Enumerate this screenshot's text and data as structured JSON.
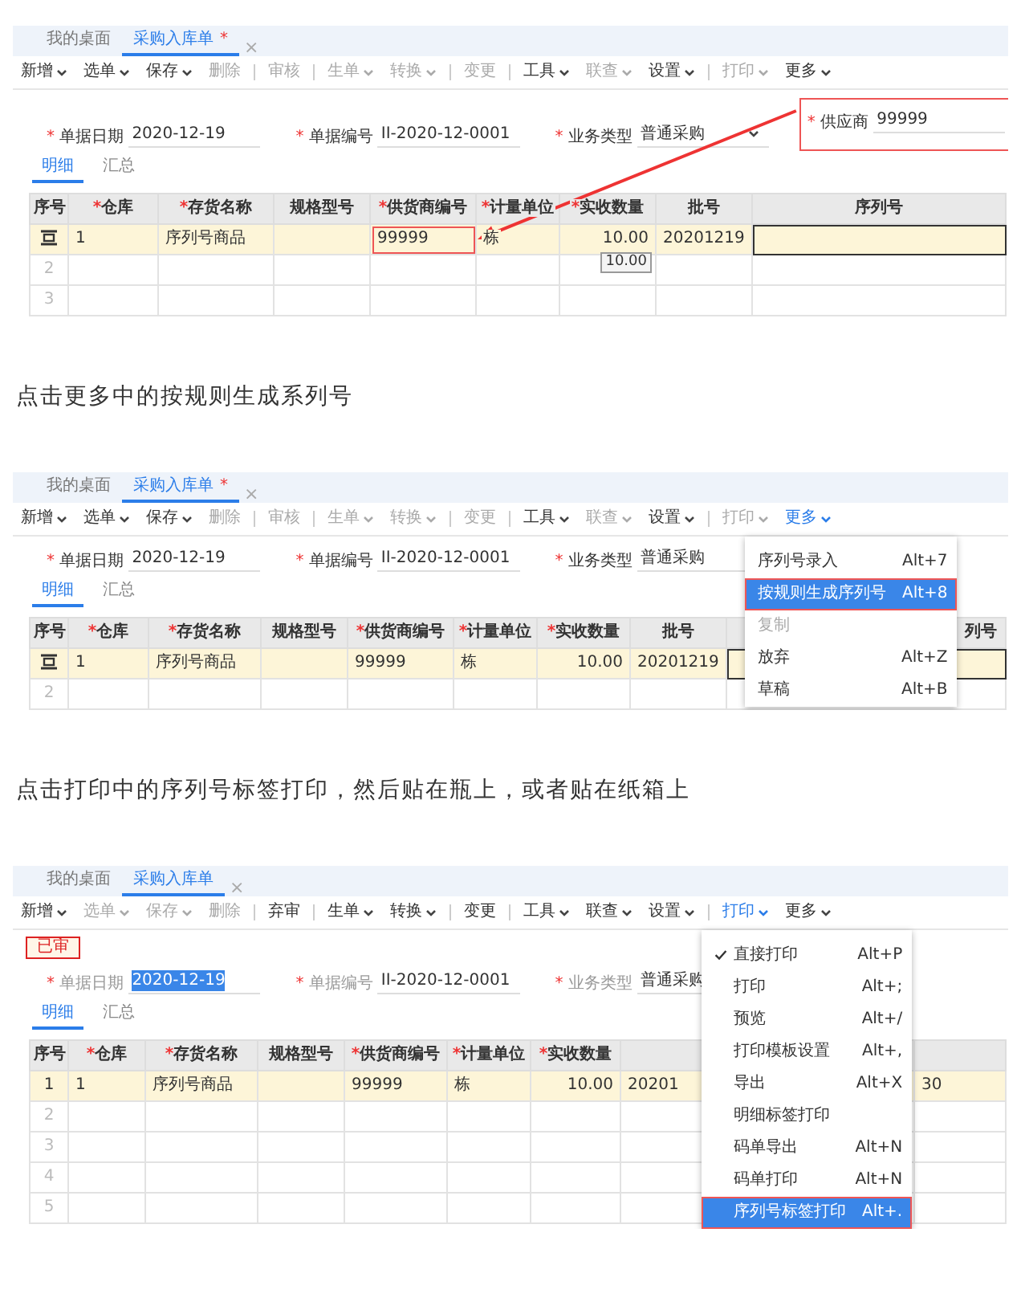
{
  "blocks": [
    {
      "kind": "screen",
      "arrow": true,
      "tabs": [
        {
          "label": "我的桌面",
          "selected": false
        },
        {
          "label": "采购入库单",
          "mark": "*",
          "selected": true,
          "close": "×"
        }
      ],
      "toolbar": [
        {
          "label": "新增",
          "dropdown": true,
          "disabled": false
        },
        {
          "label": "选单",
          "dropdown": true,
          "disabled": false
        },
        {
          "label": "保存",
          "dropdown": true,
          "disabled": false
        },
        {
          "label": "删除",
          "disabled": true
        },
        {
          "label": "审核",
          "disabled": true,
          "divider_before": true
        },
        {
          "label": "生单",
          "dropdown": true,
          "disabled": true,
          "divider_before": true
        },
        {
          "label": "转换",
          "dropdown": true,
          "disabled": true
        },
        {
          "label": "变更",
          "disabled": true,
          "divider_before": true
        },
        {
          "label": "工具",
          "dropdown": true,
          "disabled": false,
          "divider_before": true
        },
        {
          "label": "联查",
          "dropdown": true,
          "disabled": true
        },
        {
          "label": "设置",
          "dropdown": true,
          "disabled": false
        },
        {
          "label": "打印",
          "dropdown": true,
          "disabled": true,
          "divider_before": true
        },
        {
          "label": "更多",
          "dropdown": true,
          "disabled": false
        }
      ],
      "fields": [
        {
          "mark": "*",
          "label": "单据日期",
          "value": "2020-12-19"
        },
        {
          "mark": "*",
          "label": "单据编号",
          "value": "II-2020-12-0001"
        },
        {
          "mark": "*",
          "label": "业务类型",
          "value": "普通采购",
          "select": true
        },
        {
          "mark": "*",
          "label": "供应商",
          "value": "99999",
          "highlight": true
        }
      ],
      "subtabs": [
        {
          "label": "明细",
          "selected": true
        },
        {
          "label": "汇总",
          "selected": false
        }
      ],
      "columns": [
        {
          "label": "序号"
        },
        {
          "mark": "*",
          "label": "仓库"
        },
        {
          "mark": "*",
          "label": "存货名称"
        },
        {
          "label": "规格型号"
        },
        {
          "mark": "*",
          "label": "供货商编号"
        },
        {
          "mark": "*",
          "label": "计量单位"
        },
        {
          "mark": "*",
          "label": "实收数量"
        },
        {
          "label": "批号"
        },
        {
          "label": "序列号"
        }
      ],
      "rows": [
        {
          "kind": "editing",
          "selected": true,
          "cells": [
            {},
            {
              "text": "1"
            },
            {
              "text": "序列号商品"
            },
            {},
            {
              "text": "99999",
              "highlight": true
            },
            {
              "text": "栋"
            },
            {
              "text": "10.00",
              "tooltip": "10.00"
            },
            {
              "text": "20201219"
            },
            {
              "focused": true
            }
          ]
        },
        {
          "kind": "plain",
          "selected": false,
          "cells": [
            {
              "text": "2"
            },
            {},
            {},
            {},
            {},
            {},
            {},
            {},
            {}
          ]
        },
        {
          "kind": "plain",
          "selected": false,
          "cells": [
            {
              "text": "3"
            },
            {},
            {},
            {},
            {},
            {},
            {},
            {},
            {}
          ]
        }
      ]
    },
    {
      "kind": "caption",
      "text": "点击更多中的按规则生成系列号"
    },
    {
      "kind": "screen",
      "tabs": [
        {
          "label": "我的桌面",
          "selected": false
        },
        {
          "label": "采购入库单",
          "mark": "*",
          "selected": true,
          "close": "×"
        }
      ],
      "toolbar": [
        {
          "label": "新增",
          "dropdown": true,
          "disabled": false
        },
        {
          "label": "选单",
          "dropdown": true,
          "disabled": false
        },
        {
          "label": "保存",
          "dropdown": true,
          "disabled": false
        },
        {
          "label": "删除",
          "disabled": true
        },
        {
          "label": "审核",
          "disabled": true,
          "divider_before": true
        },
        {
          "label": "生单",
          "dropdown": true,
          "disabled": true,
          "divider_before": true
        },
        {
          "label": "转换",
          "dropdown": true,
          "disabled": true
        },
        {
          "label": "变更",
          "disabled": true,
          "divider_before": true
        },
        {
          "label": "工具",
          "dropdown": true,
          "disabled": false,
          "divider_before": true
        },
        {
          "label": "联查",
          "dropdown": true,
          "disabled": true
        },
        {
          "label": "设置",
          "dropdown": true,
          "disabled": false
        },
        {
          "label": "打印",
          "dropdown": true,
          "disabled": true,
          "divider_before": true
        },
        {
          "label": "更多",
          "dropdown": true,
          "disabled": false,
          "open": true
        }
      ],
      "fields": [
        {
          "mark": "*",
          "label": "单据日期",
          "value": "2020-12-19"
        },
        {
          "mark": "*",
          "label": "单据编号",
          "value": "II-2020-12-0001"
        },
        {
          "mark": "*",
          "label": "业务类型",
          "value": "普通采购",
          "select": true
        }
      ],
      "subtabs": [
        {
          "label": "明细",
          "selected": true
        },
        {
          "label": "汇总",
          "selected": false
        }
      ],
      "columns": [
        {
          "label": "序号"
        },
        {
          "mark": "*",
          "label": "仓库"
        },
        {
          "mark": "*",
          "label": "存货名称"
        },
        {
          "label": "规格型号"
        },
        {
          "mark": "*",
          "label": "供货商编号"
        },
        {
          "mark": "*",
          "label": "计量单位"
        },
        {
          "mark": "*",
          "label": "实收数量"
        },
        {
          "label": "批号"
        },
        {
          "label": "列号"
        }
      ],
      "rows": [
        {
          "kind": "editing",
          "selected": true,
          "cells": [
            {},
            {
              "text": "1"
            },
            {
              "text": "序列号商品"
            },
            {},
            {
              "text": "99999"
            },
            {
              "text": "栋"
            },
            {
              "text": "10.00"
            },
            {
              "text": "20201219"
            },
            {
              "focused": true
            }
          ]
        },
        {
          "kind": "plain",
          "selected": false,
          "cells": [
            {
              "text": "2"
            },
            {},
            {},
            {},
            {},
            {},
            {},
            {},
            {}
          ]
        }
      ],
      "menu": {
        "items": [
          {
            "label": "序列号录入",
            "shortcut": "Alt+7",
            "selected": false
          },
          {
            "label": "按规则生成序列号",
            "shortcut": "Alt+8",
            "selected": true,
            "highlight": true
          },
          {
            "label": "复制",
            "disabled": true,
            "selected": false
          },
          {
            "label": "放弃",
            "shortcut": "Alt+Z",
            "selected": false
          },
          {
            "label": "草稿",
            "shortcut": "Alt+B",
            "selected": false
          }
        ]
      }
    },
    {
      "kind": "caption",
      "text": "点击打印中的序列号标签打印，然后贴在瓶上，或者贴在纸箱上"
    },
    {
      "kind": "screen",
      "badge": "已审",
      "tabs": [
        {
          "label": "我的桌面",
          "selected": false
        },
        {
          "label": "采购入库单",
          "selected": true,
          "close": "×"
        }
      ],
      "toolbar": [
        {
          "label": "新增",
          "dropdown": true,
          "disabled": false
        },
        {
          "label": "选单",
          "dropdown": true,
          "disabled": true
        },
        {
          "label": "保存",
          "dropdown": true,
          "disabled": true
        },
        {
          "label": "删除",
          "disabled": true
        },
        {
          "label": "弃审",
          "disabled": false,
          "divider_before": true
        },
        {
          "label": "生单",
          "dropdown": true,
          "disabled": false,
          "divider_before": true
        },
        {
          "label": "转换",
          "dropdown": true,
          "disabled": false
        },
        {
          "label": "变更",
          "disabled": false,
          "divider_before": true
        },
        {
          "label": "工具",
          "dropdown": true,
          "disabled": false,
          "divider_before": true
        },
        {
          "label": "联查",
          "dropdown": true,
          "disabled": false
        },
        {
          "label": "设置",
          "dropdown": true,
          "disabled": false
        },
        {
          "label": "打印",
          "dropdown": true,
          "disabled": false,
          "divider_before": true,
          "open": true
        },
        {
          "label": "更多",
          "dropdown": true,
          "disabled": false
        }
      ],
      "fields": [
        {
          "mark": "*",
          "label": "单据日期",
          "value": "2020-12-19",
          "disabled": true,
          "selected": true
        },
        {
          "mark": "*",
          "label": "单据编号",
          "value": "II-2020-12-0001",
          "disabled": true,
          "selected": false
        },
        {
          "mark": "*",
          "label": "业务类型",
          "value": "普通采购",
          "disabled": true,
          "selected": false
        }
      ],
      "subtabs": [
        {
          "label": "明细",
          "selected": true
        },
        {
          "label": "汇总",
          "selected": false
        }
      ],
      "columns": [
        {
          "label": "序号"
        },
        {
          "mark": "*",
          "label": "仓库"
        },
        {
          "mark": "*",
          "label": "存货名称"
        },
        {
          "label": "规格型号"
        },
        {
          "mark": "*",
          "label": "供货商编号"
        },
        {
          "mark": "*",
          "label": "计量单位"
        },
        {
          "mark": "*",
          "label": "实收数量"
        },
        {},
        {}
      ],
      "rows": [
        {
          "kind": "plain",
          "selected": true,
          "cells": [
            {
              "text": "1"
            },
            {
              "text": "1"
            },
            {
              "text": "序列号商品"
            },
            {},
            {
              "text": "99999"
            },
            {
              "text": "栋"
            },
            {
              "text": "10.00"
            },
            {
              "text": "20201"
            },
            {
              "text": "30"
            }
          ]
        },
        {
          "kind": "plain",
          "selected": false,
          "cells": [
            {
              "text": "2"
            },
            {},
            {},
            {},
            {},
            {},
            {},
            {},
            {}
          ]
        },
        {
          "kind": "plain",
          "selected": false,
          "cells": [
            {
              "text": "3"
            },
            {},
            {},
            {},
            {},
            {},
            {},
            {},
            {}
          ]
        },
        {
          "kind": "plain",
          "selected": false,
          "cells": [
            {
              "text": "4"
            },
            {},
            {},
            {},
            {},
            {},
            {},
            {},
            {}
          ]
        },
        {
          "kind": "plain",
          "selected": false,
          "cells": [
            {
              "text": "5"
            },
            {},
            {},
            {},
            {},
            {},
            {},
            {},
            {}
          ]
        }
      ],
      "menu": {
        "items": [
          {
            "label": "直接打印",
            "shortcut": "Alt+P",
            "checked": true,
            "selected": false
          },
          {
            "label": "打印",
            "shortcut": "Alt+;",
            "checked": false,
            "selected": false
          },
          {
            "label": "预览",
            "shortcut": "Alt+/",
            "checked": false,
            "selected": false
          },
          {
            "label": "打印模板设置",
            "shortcut": "Alt+,",
            "checked": false,
            "selected": false
          },
          {
            "label": "导出",
            "shortcut": "Alt+X",
            "checked": false,
            "selected": false
          },
          {
            "label": "明细标签打印",
            "checked": false,
            "selected": false
          },
          {
            "label": "码单导出",
            "shortcut": "Alt+N",
            "checked": false,
            "selected": false
          },
          {
            "label": "码单打印",
            "shortcut": "Alt+N",
            "checked": false,
            "selected": false
          },
          {
            "label": "序列号标签打印",
            "shortcut": "Alt+.",
            "checked": false,
            "selected": true,
            "highlight": true
          }
        ]
      }
    }
  ]
}
